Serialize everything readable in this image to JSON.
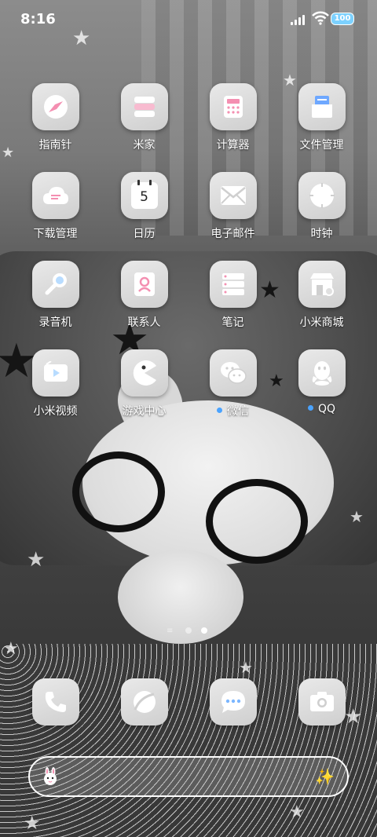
{
  "status_bar": {
    "time": "8:16",
    "battery": "100"
  },
  "apps": [
    {
      "label": "指南针",
      "icon": "compass-icon"
    },
    {
      "label": "米家",
      "icon": "mijia-icon"
    },
    {
      "label": "计算器",
      "icon": "calculator-icon"
    },
    {
      "label": "文件管理",
      "icon": "file-manager-icon"
    },
    {
      "label": "下载管理",
      "icon": "download-cloud-icon"
    },
    {
      "label": "日历",
      "icon": "calendar-icon",
      "day": "5"
    },
    {
      "label": "电子邮件",
      "icon": "mail-icon"
    },
    {
      "label": "时钟",
      "icon": "clock-icon"
    },
    {
      "label": "录音机",
      "icon": "microphone-icon"
    },
    {
      "label": "联系人",
      "icon": "contacts-icon"
    },
    {
      "label": "笔记",
      "icon": "notes-icon"
    },
    {
      "label": "小米商城",
      "icon": "store-icon"
    },
    {
      "label": "小米视频",
      "icon": "video-icon"
    },
    {
      "label": "游戏中心",
      "icon": "game-center-icon"
    },
    {
      "label": "微信",
      "icon": "wechat-icon",
      "has_update": true
    },
    {
      "label": "QQ",
      "icon": "qq-icon",
      "has_update": true
    }
  ],
  "dock": [
    {
      "icon": "phone-icon"
    },
    {
      "icon": "browser-icon"
    },
    {
      "icon": "messages-icon"
    },
    {
      "icon": "camera-icon"
    }
  ],
  "page_indicator": {
    "pages": 2,
    "current": 2
  },
  "search_bar": {
    "left_icon": "bunny-icon",
    "right_icon": "sparkle-icon",
    "right_glyph": "✨"
  },
  "colors": {
    "accent_dot": "#4aa3ff",
    "icon_bg": "#dcdcdc",
    "pink_accent": "#f48fb1",
    "battery": "#7cd1ff"
  }
}
